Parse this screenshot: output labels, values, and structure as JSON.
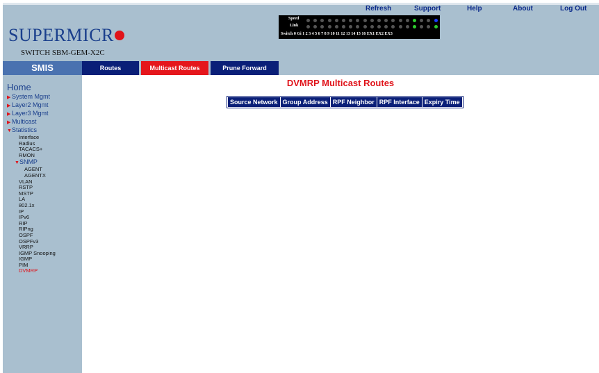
{
  "brand": {
    "logo_text": "SUPERMICR",
    "model": "SWITCH SBM-GEM-X2C"
  },
  "top_links": [
    "Refresh",
    "Support",
    "Help",
    "About",
    "Log Out"
  ],
  "port_panel": {
    "speed_label": "Speed",
    "link_label": "Link",
    "ports_label": "Switch 0 Gi  1  2  3  4  5  6  7  8  9  10 11 12 13 14 15 16 EX1 EX2 EX3"
  },
  "nav": {
    "smis": "SMIS",
    "tabs": [
      "Routes",
      "Multicast Routes",
      "Prune Forward"
    ],
    "active_tab": "Multicast Routes"
  },
  "sidebar": {
    "home": "Home",
    "top_items": [
      "System Mgmt",
      "Layer2 Mgmt",
      "Layer3 Mgmt",
      "Multicast"
    ],
    "statistics": "Statistics",
    "stats_items_a": [
      "Interface",
      "Radius",
      "TACACS+",
      "RMON"
    ],
    "snmp": "SNMP",
    "snmp_items": [
      "AGENT",
      "AGENTX"
    ],
    "stats_items_b": [
      "VLAN",
      "RSTP",
      "MSTP",
      "LA",
      "802.1x",
      "IP",
      "IPv6",
      "RIP",
      "RIPng",
      "OSPF",
      "OSPFv3",
      "VRRP",
      "IGMP Snooping",
      "IGMP",
      "PIM"
    ],
    "selected": "DVMRP"
  },
  "page": {
    "title": "DVMRP Multicast Routes",
    "columns": [
      "Source Network",
      "Group Address",
      "RPF Neighbor",
      "RPF Interface",
      "Expiry Time"
    ]
  },
  "colors": {
    "accent_red": "#e0131a",
    "navy": "#0a1f78",
    "panel_blue": "#a9bfcf",
    "smis_blue": "#4a72b0"
  }
}
